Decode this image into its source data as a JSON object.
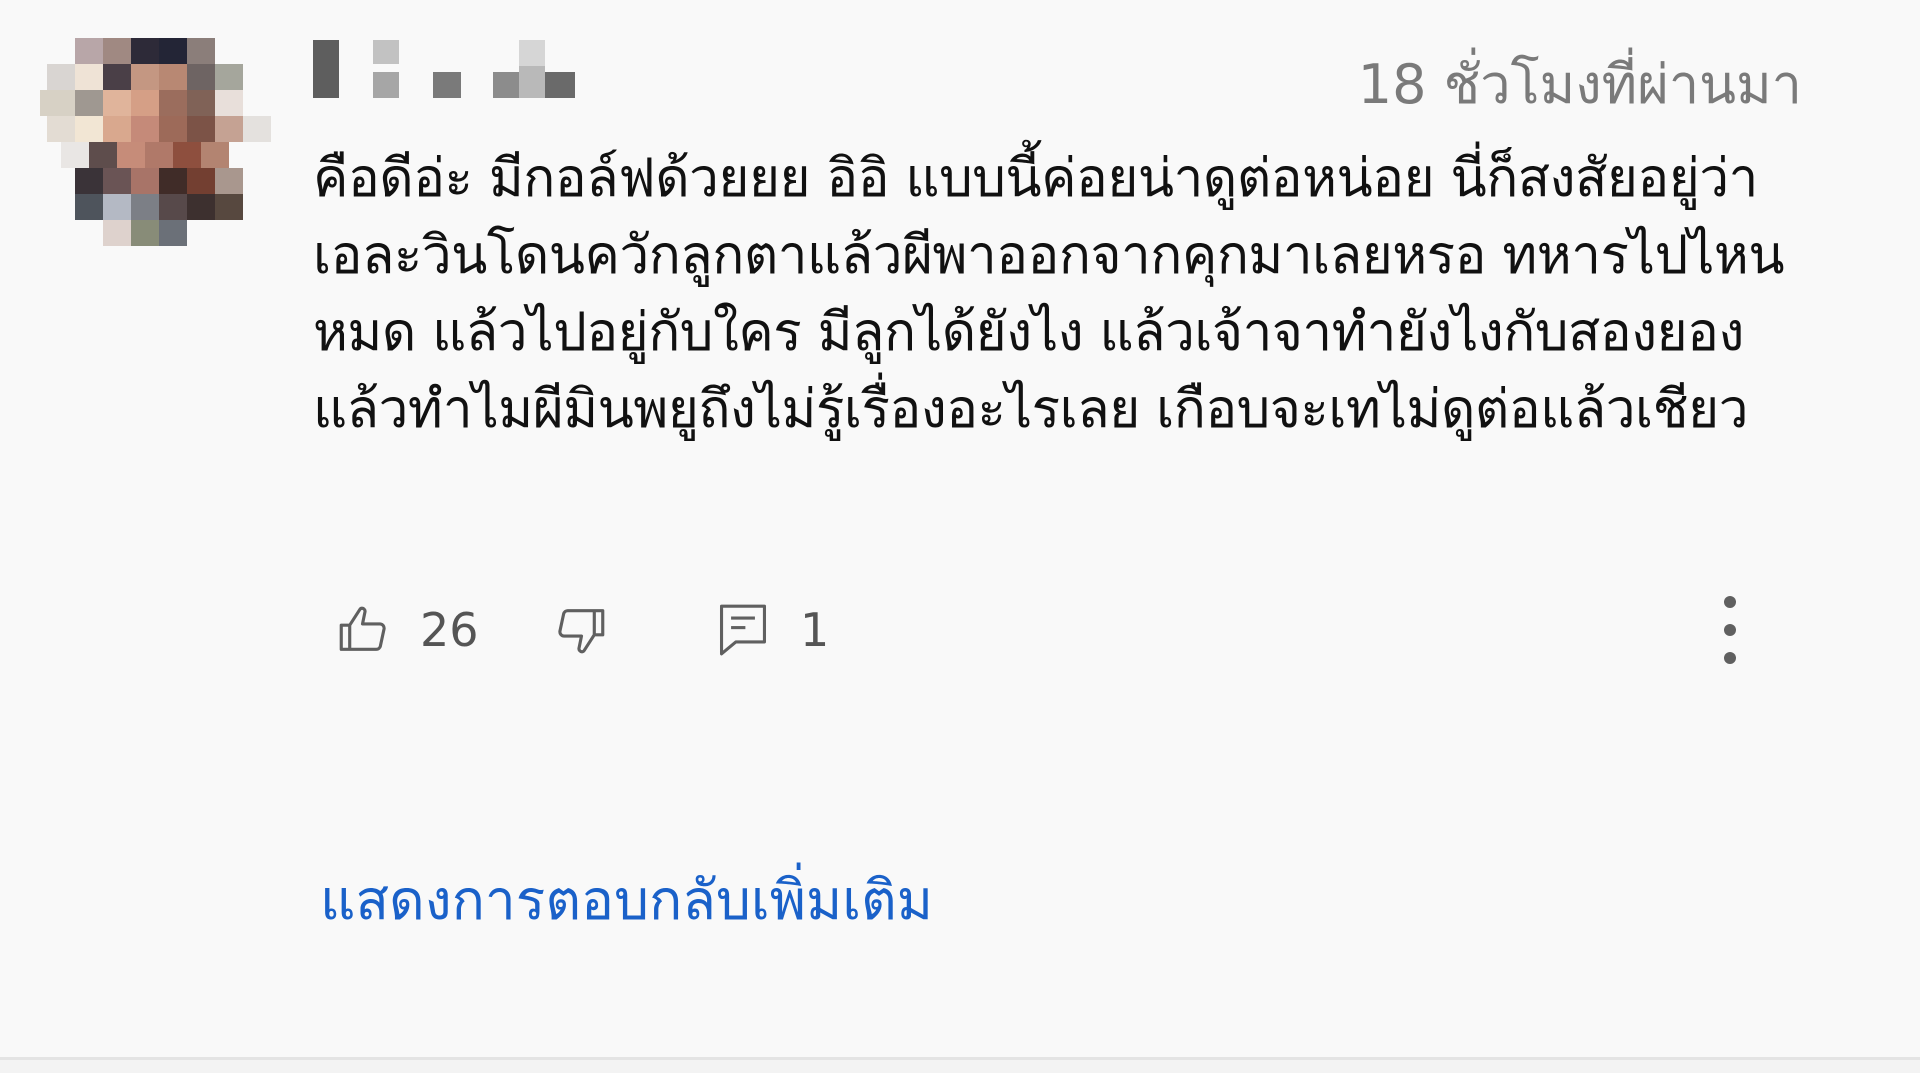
{
  "comment": {
    "timestamp": "18 ชั่วโมงที่ผ่านมา",
    "text": "คือดีอ่ะ มีกอล์ฟด้วยยย อิอิ แบบนี้ค่อยน่าดูต่อหน่อย นี่ก็สงสัยอยู่ว่าเอละวินโดนควักลูกตาแล้วผีพาออกจากคุกมาเลยหรอ ทหารไปไหนหมด แล้วไปอยู่กับใคร มีลูกได้ยังไง แล้วเจ้าจาทำยังไงกับสองยอง แล้วทำไมผีมินพยูถึงไม่รู้เรื่องอะไรเลย เกือบจะเทไม่ดูต่อแล้วเชียว",
    "likes": "26",
    "replies": "1",
    "show_more_replies": "แสดงการตอบกลับเพิ่มเติม"
  },
  "icons": {
    "like": "thumb-up-icon",
    "dislike": "thumb-down-icon",
    "reply": "comment-icon",
    "more": "more-vertical-icon"
  },
  "colors": {
    "background": "#f9f9f9",
    "timestamp": "#7a7a7a",
    "link": "#1a61c9",
    "icon": "#606060"
  }
}
